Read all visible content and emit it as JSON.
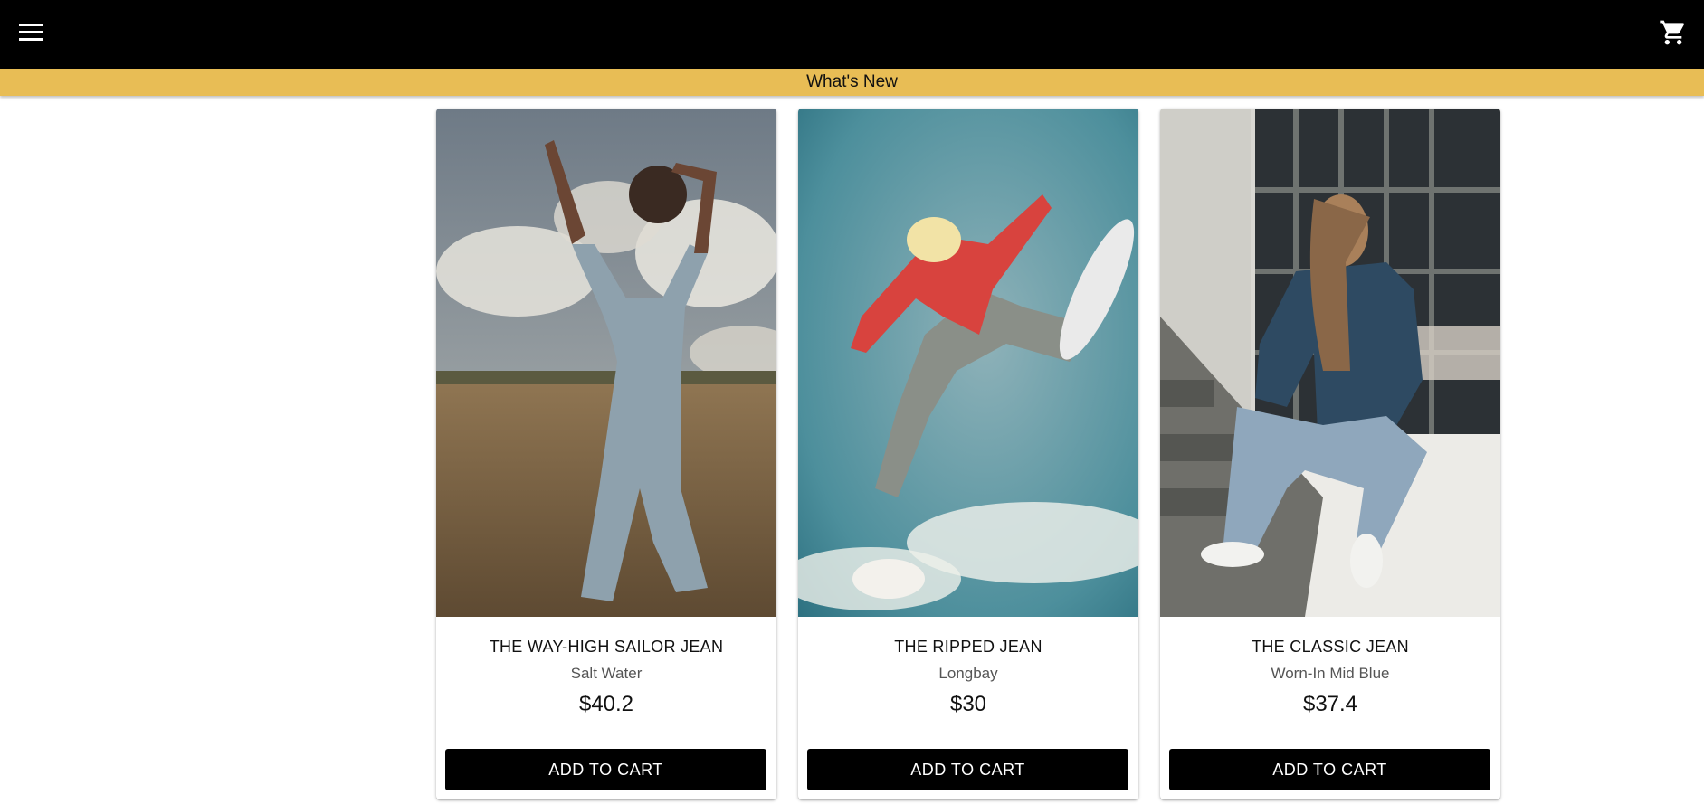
{
  "header": {
    "menu_icon": "hamburger-menu-icon",
    "cart_icon": "shopping-cart-icon",
    "background": "#000000"
  },
  "banner": {
    "label": "What's New",
    "color": "#e8bd55"
  },
  "products": [
    {
      "name": "THE WAY-HIGH SAILOR JEAN",
      "color": "Salt Water",
      "price": "$40.2",
      "cta": "ADD TO CART"
    },
    {
      "name": "THE RIPPED JEAN",
      "color": "Longbay",
      "price": "$30",
      "cta": "ADD TO CART"
    },
    {
      "name": "THE CLASSIC JEAN",
      "color": "Worn-In Mid Blue",
      "price": "$37.4",
      "cta": "ADD TO CART"
    }
  ]
}
